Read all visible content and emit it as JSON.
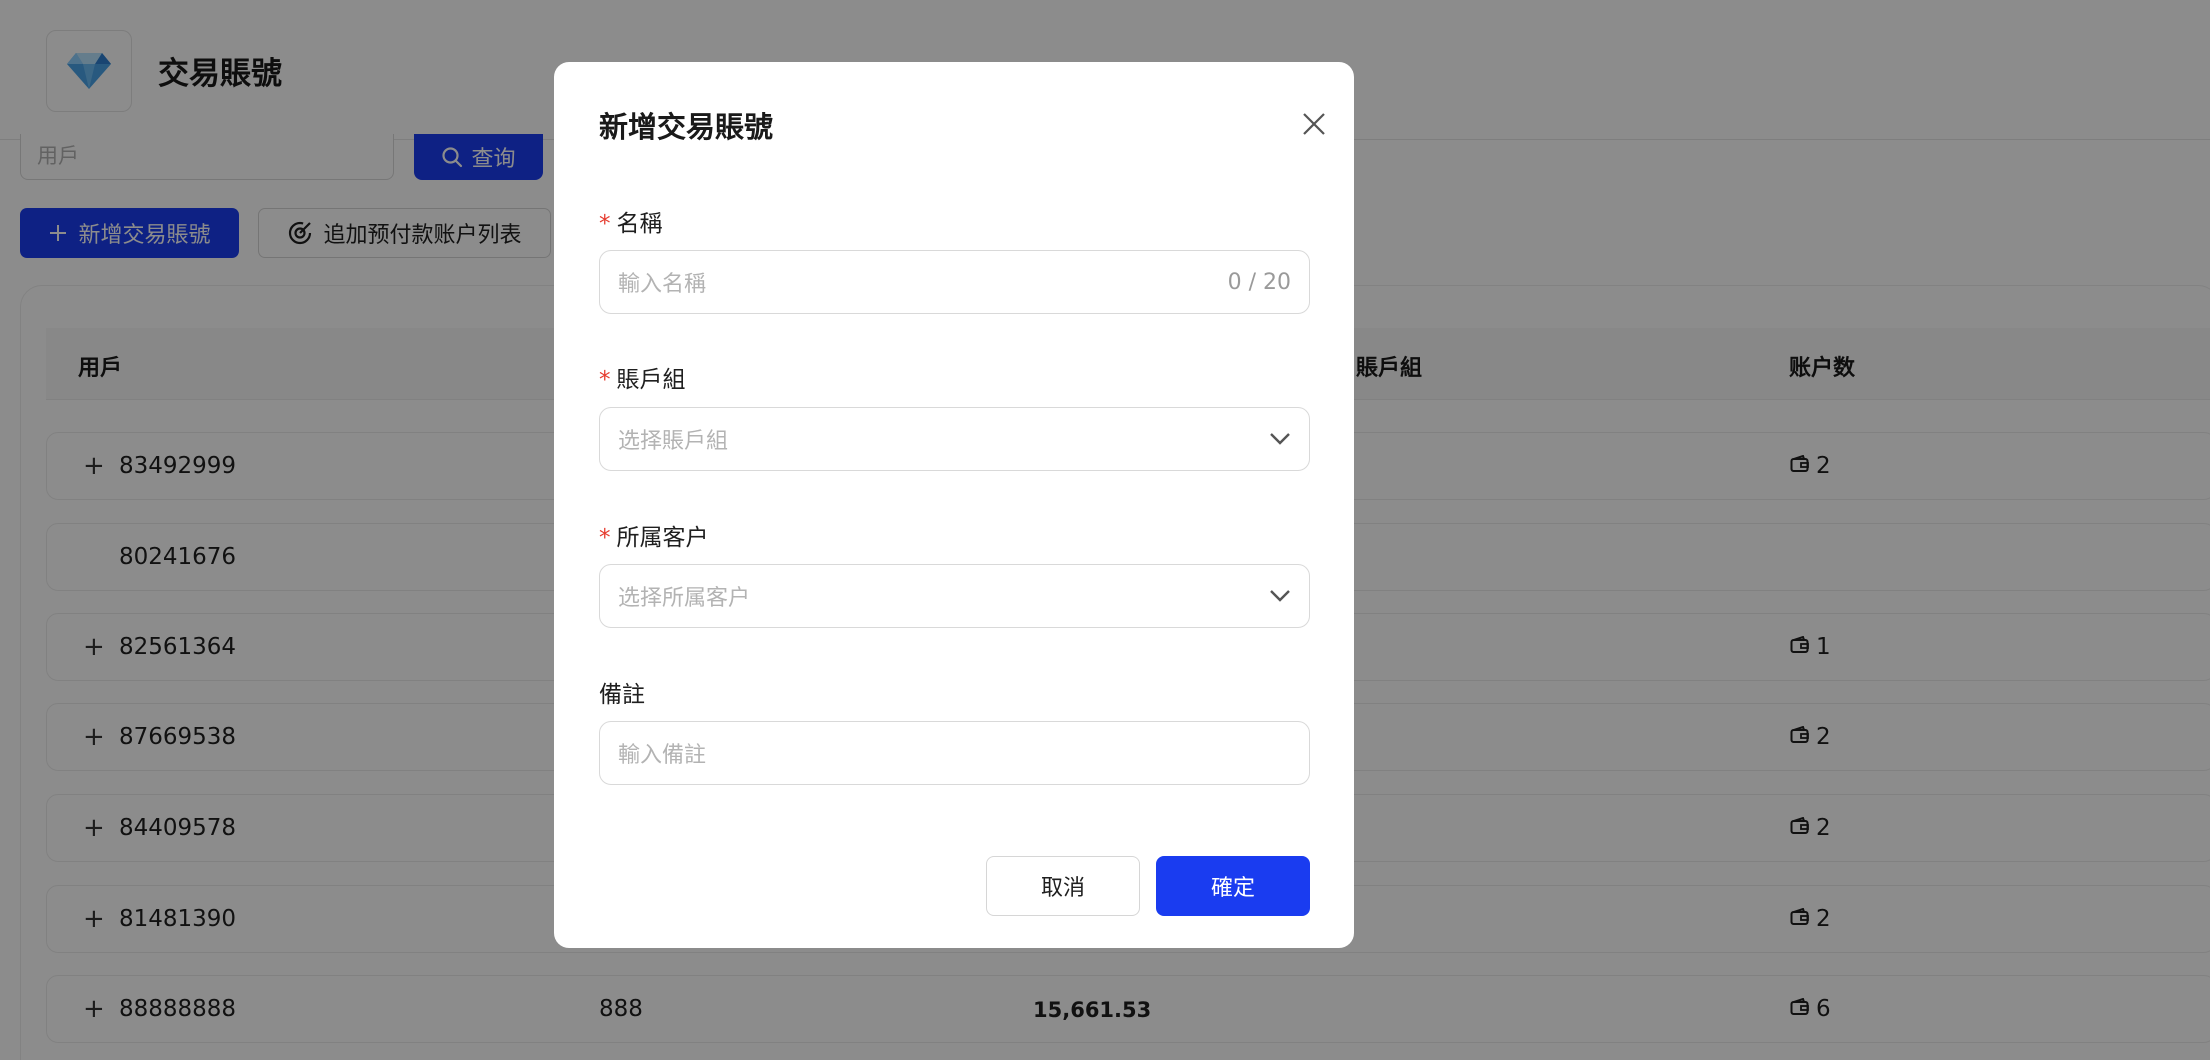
{
  "page": {
    "title": "交易賬號",
    "search_placeholder": "用戶",
    "query_label": "查询",
    "add_label": "新增交易賬號",
    "prepay_label": "追加预付款账户列表"
  },
  "table": {
    "headers": {
      "user": "用戶",
      "group": "賬戶組",
      "count": "账户数"
    },
    "rows": [
      {
        "user": "83492999",
        "expandable": "+",
        "col2": "",
        "col3": "",
        "count": "2"
      },
      {
        "user": "80241676",
        "expandable": "",
        "col2": "",
        "col3": "",
        "count": ""
      },
      {
        "user": "82561364",
        "expandable": "+",
        "col2": "",
        "col3": "",
        "count": "1"
      },
      {
        "user": "87669538",
        "expandable": "+",
        "col2": "",
        "col3": "",
        "count": "2"
      },
      {
        "user": "84409578",
        "expandable": "+",
        "col2": "",
        "col3": "",
        "count": "2"
      },
      {
        "user": "81481390",
        "expandable": "+",
        "col2": "",
        "col3": "",
        "count": "2"
      },
      {
        "user": "88888888",
        "expandable": "+",
        "col2": "888",
        "col3": "15,661.53",
        "count": "6"
      }
    ]
  },
  "modal": {
    "title": "新增交易賬號",
    "required_mark": "*",
    "name_label": "名稱",
    "name_placeholder": "輸入名稱",
    "name_counter": "0 / 20",
    "group_label": "賬戶組",
    "group_placeholder": "选择賬戶組",
    "customer_label": "所属客户",
    "customer_placeholder": "选择所属客户",
    "remark_label": "備註",
    "remark_placeholder": "輸入備註",
    "cancel_label": "取消",
    "ok_label": "確定"
  },
  "colors": {
    "primary": "#1a3cf0",
    "required": "#e63b2e",
    "overlay": "rgba(0,0,0,0.45)"
  }
}
